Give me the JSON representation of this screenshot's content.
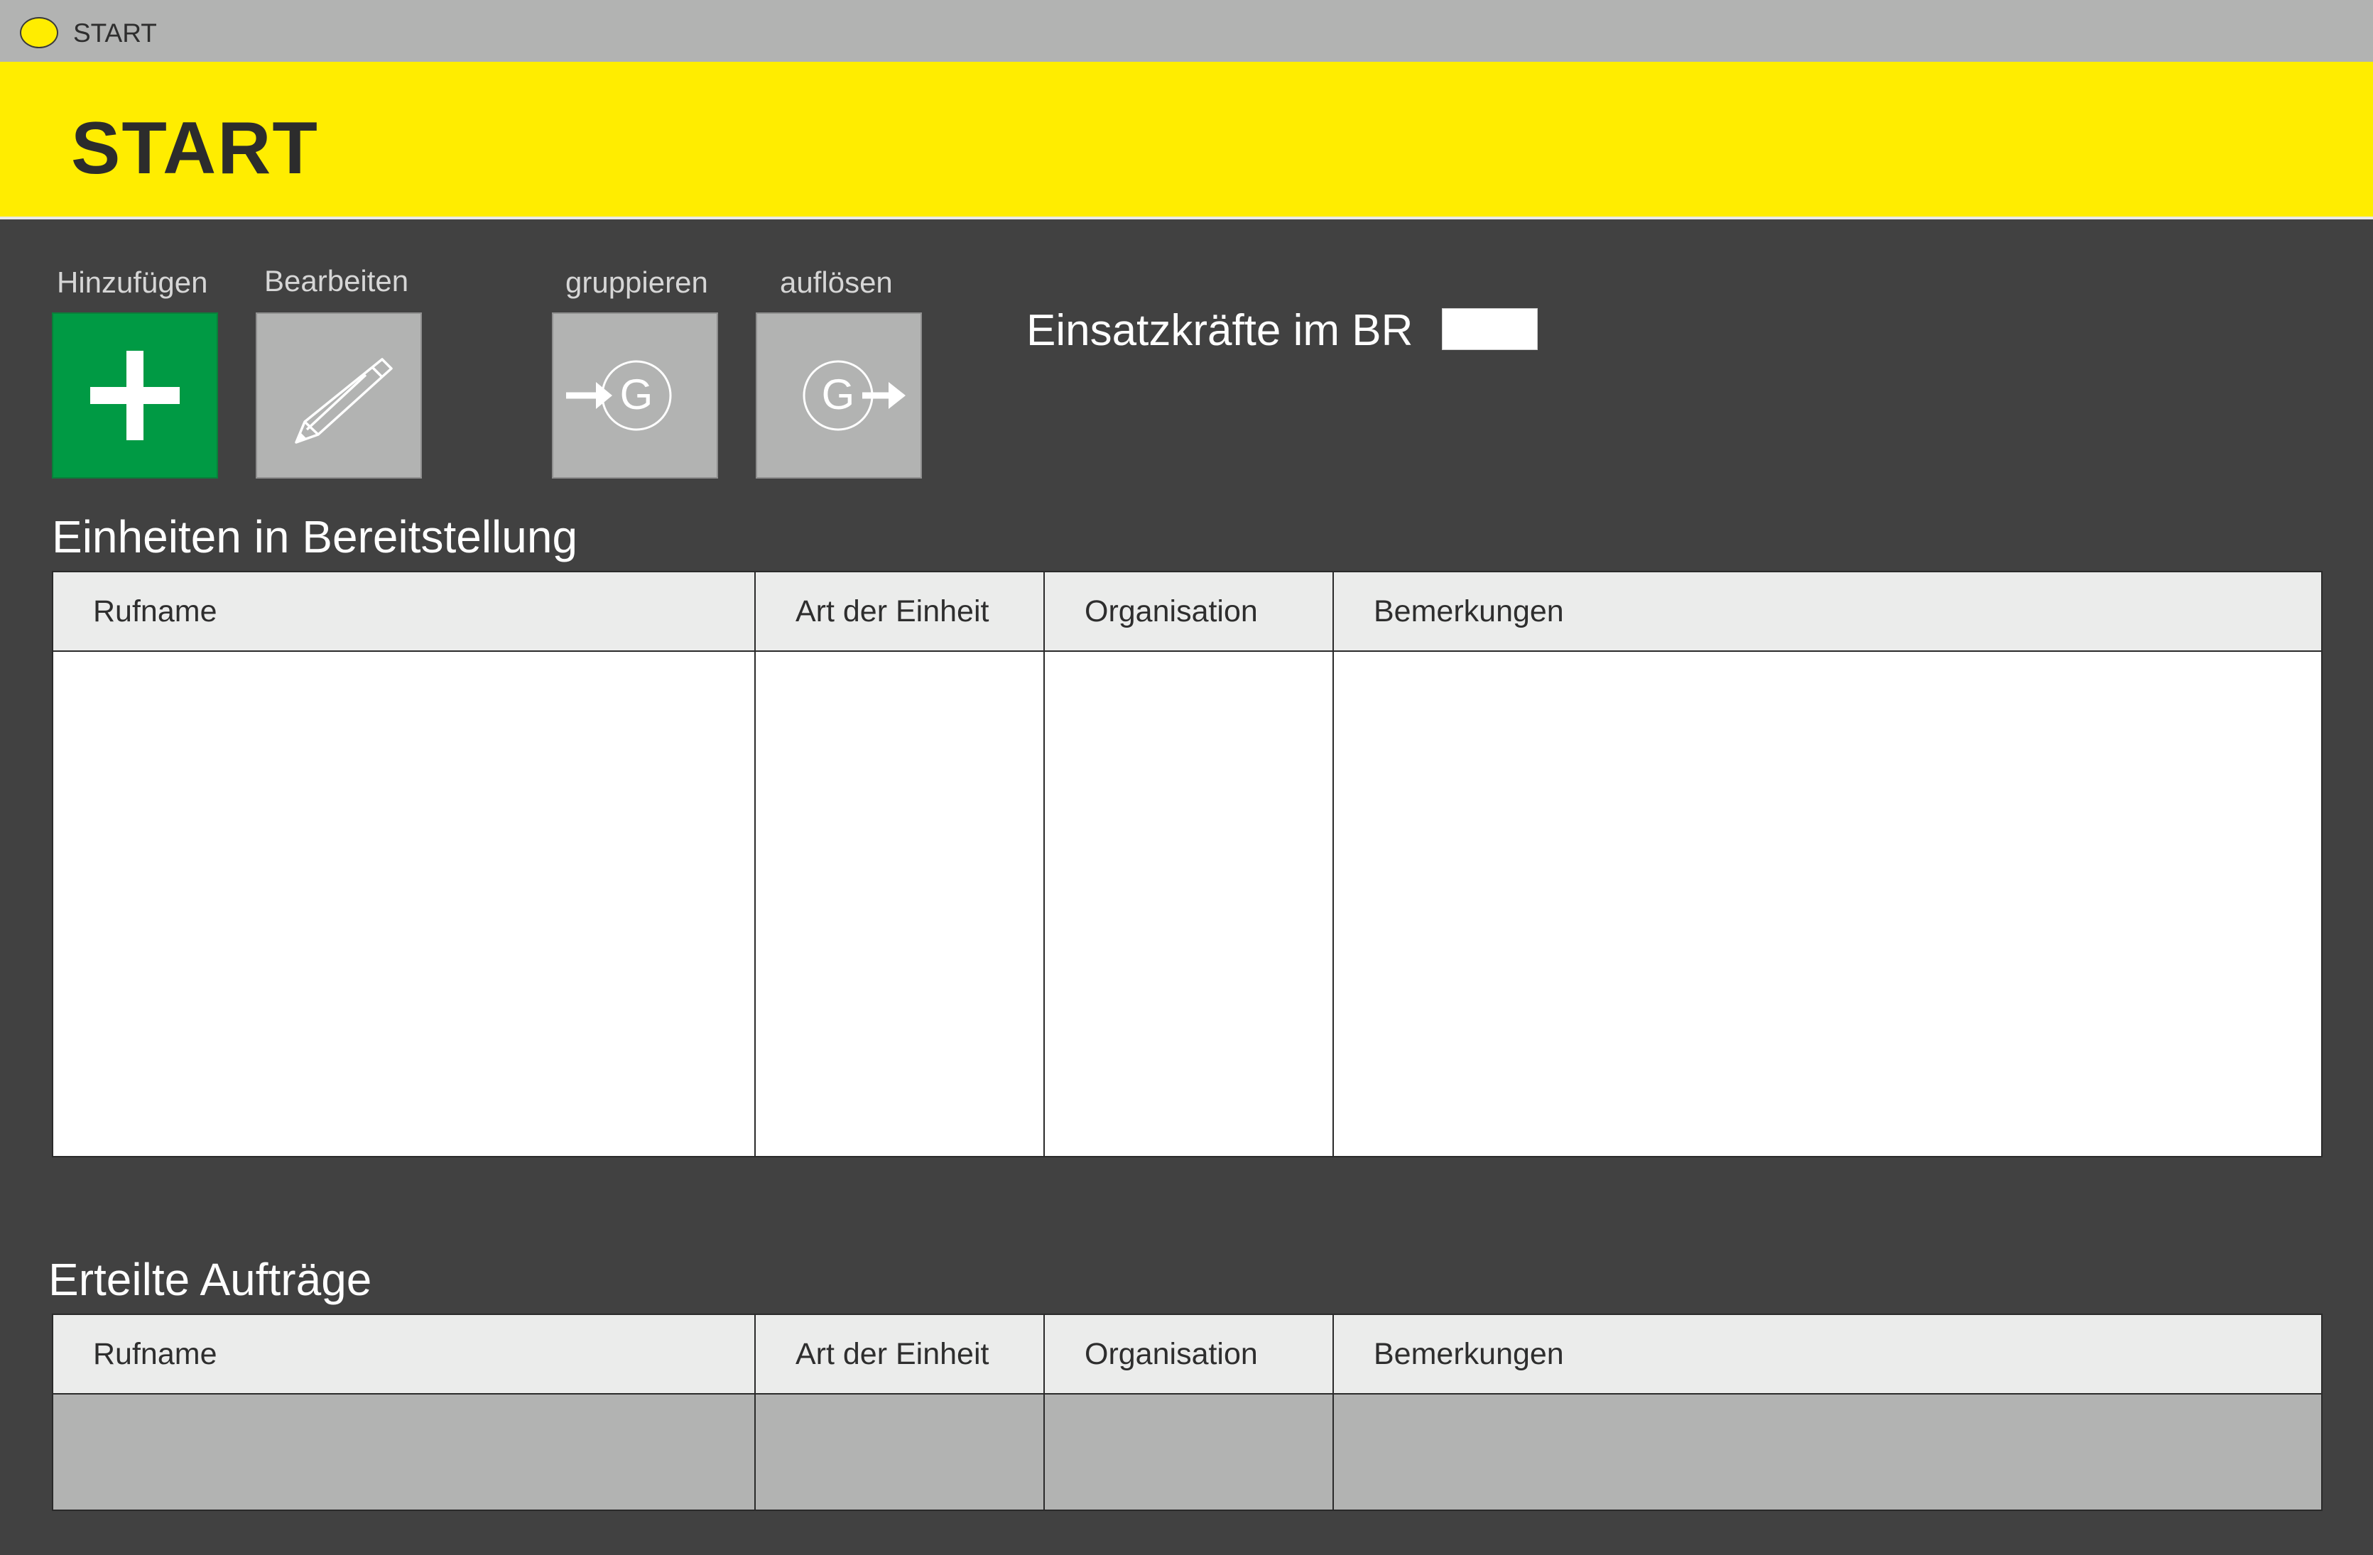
{
  "window": {
    "title": "START"
  },
  "header": {
    "title": "START"
  },
  "toolbar": {
    "add_label": "Hinzufügen",
    "edit_label": "Bearbeiten",
    "group_label": "gruppieren",
    "ungroup_label": "auflösen",
    "group_icon_letter": "G"
  },
  "forces": {
    "label": "Einsatzkräfte im BR",
    "value": ""
  },
  "staging": {
    "title": "Einheiten in Bereitstellung",
    "columns": [
      "Rufname",
      "Art der Einheit",
      "Organisation",
      "Bemerkungen"
    ],
    "rows": []
  },
  "orders": {
    "title": "Erteilte Aufträge",
    "columns": [
      "Rufname",
      "Art der Einheit",
      "Organisation",
      "Bemerkungen"
    ],
    "rows": []
  },
  "colors": {
    "accent_yellow": "#ffed00",
    "add_green": "#009a44",
    "background": "#414141",
    "titlebar_gray": "#b2b3b2",
    "button_gray": "#b2b3b2"
  },
  "icons": {
    "titlebar": "status-dot-icon",
    "add": "plus-icon",
    "edit": "pencil-icon",
    "group": "arrow-into-group-icon",
    "ungroup": "arrow-out-of-group-icon"
  }
}
